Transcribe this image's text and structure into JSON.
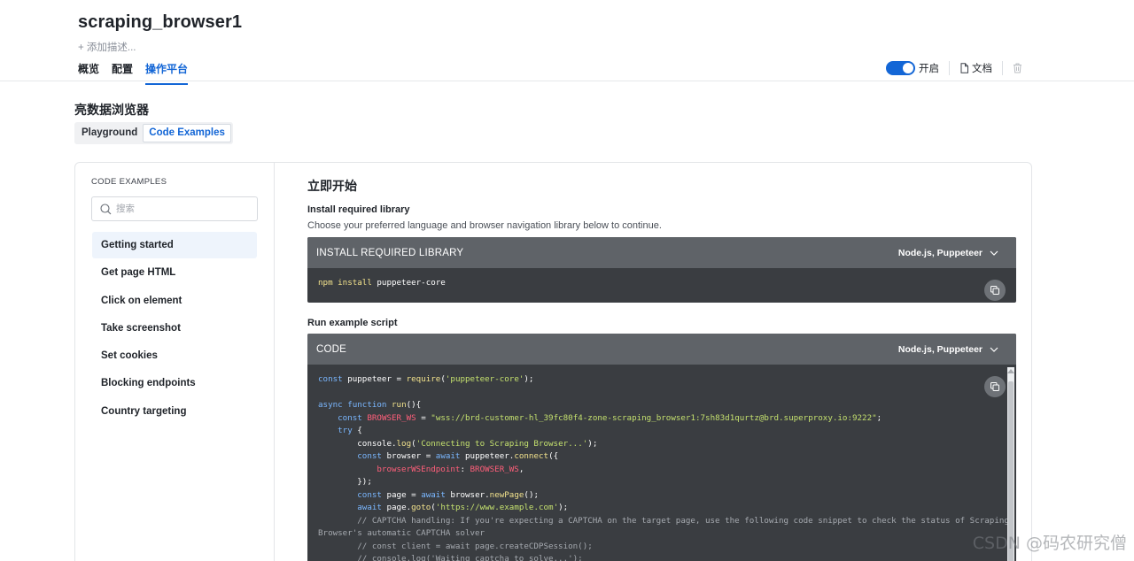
{
  "header": {
    "title": "scraping_browser1",
    "add_description": "+ 添加描述...",
    "tabs": [
      {
        "label": "概览",
        "active": false
      },
      {
        "label": "配置",
        "active": false
      },
      {
        "label": "操作平台",
        "active": true
      }
    ],
    "toggle_label": "开启",
    "toggle_on": true,
    "docs_label": "文档",
    "icons": [
      "document-icon",
      "trash-icon"
    ]
  },
  "section": {
    "title": "亮数据浏览器",
    "segments": [
      {
        "label": "Playground",
        "active": false
      },
      {
        "label": "Code Examples",
        "active": true
      }
    ]
  },
  "sidebar": {
    "heading": "CODE EXAMPLES",
    "search_placeholder": "搜索",
    "items": [
      {
        "label": "Getting started",
        "active": true
      },
      {
        "label": "Get page HTML",
        "active": false
      },
      {
        "label": "Click on element",
        "active": false
      },
      {
        "label": "Take screenshot",
        "active": false
      },
      {
        "label": "Set cookies",
        "active": false
      },
      {
        "label": "Blocking endpoints",
        "active": false
      },
      {
        "label": "Country targeting",
        "active": false
      }
    ]
  },
  "content": {
    "title": "立即开始",
    "install_heading": "Install required library",
    "description": "Choose your preferred language and browser navigation library below to continue.",
    "install_block": {
      "label": "INSTALL REQUIRED LIBRARY",
      "language": "Node.js, Puppeteer",
      "command_kw": "npm install",
      "command_arg": " puppeteer-core"
    },
    "run_heading": "Run example script",
    "code_block": {
      "label": "CODE",
      "language": "Node.js, Puppeteer"
    }
  },
  "colors": {
    "accent": "#1366d6",
    "code_bg": "#3a3d41",
    "code_header_bg": "#5f6368"
  },
  "watermark": "CSDN @码农研究僧"
}
